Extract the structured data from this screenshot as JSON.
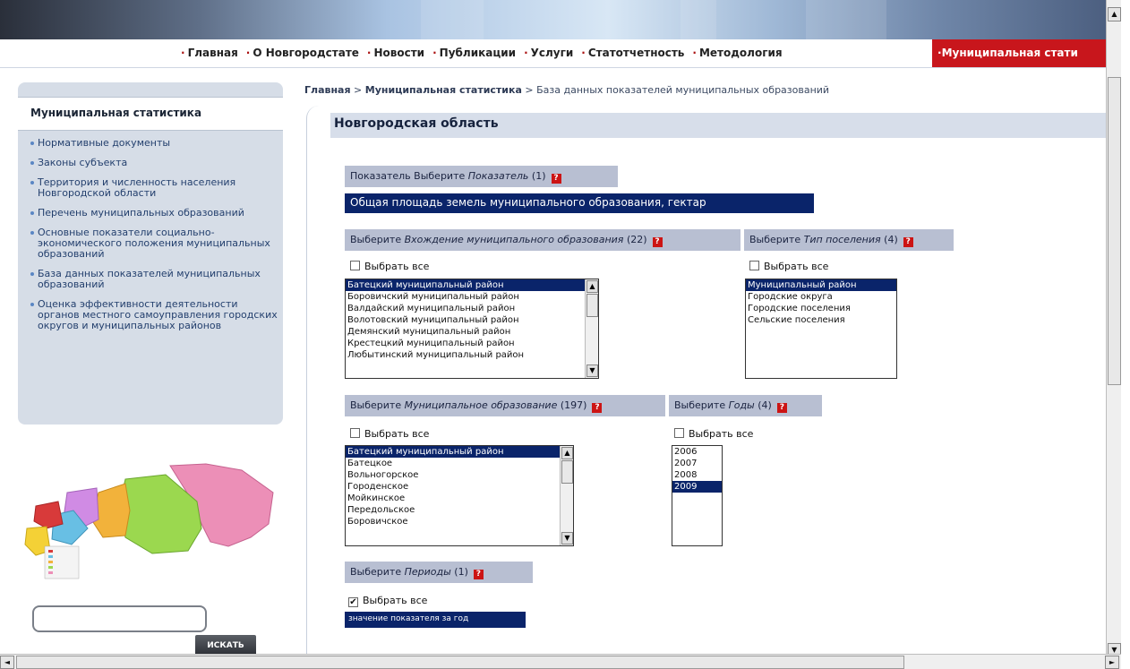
{
  "nav": {
    "items": [
      "Главная",
      "О Новгородстате",
      "Новости",
      "Публикации",
      "Услуги",
      "Статотчетность",
      "Методология"
    ],
    "active": "Муниципальная стати"
  },
  "sidebar": {
    "title": "Муниципальная статистика",
    "items": [
      "Нормативные документы",
      "Законы субъекта",
      "Территория и численность населения Новгородской области",
      "Перечень муниципальных образований",
      "Основные показатели социально-экономического положения муниципальных образований",
      "База данных показателей муниципальных образований",
      "Оценка эффективности деятельности органов местного самоуправления городских округов и муниципальных районов"
    ]
  },
  "search": {
    "button": "ИСКАТЬ"
  },
  "breadcrumb": {
    "home": "Главная",
    "section": "Муниципальная статистика",
    "current": "База данных показателей муниципальных образований",
    "sep": " > "
  },
  "region": "Новгородская область",
  "indicator": {
    "prefix": "Показатель Выберите ",
    "name": "Показатель",
    "count": "(1)",
    "value": "Общая площадь земель муниципального образования, гектар"
  },
  "select_all": "Выбрать все",
  "entry": {
    "prefix": "Выберите ",
    "name": "Вхождение муниципального образования",
    "count": "(22)",
    "options": [
      "Батецкий муниципальный район",
      "Боровичский муниципальный район",
      "Валдайский муниципальный район",
      "Волотовский муниципальный район",
      "Демянский муниципальный район",
      "Крестецкий муниципальный район",
      "Любытинский муниципальный район"
    ]
  },
  "settlement_type": {
    "prefix": "Выберите ",
    "name": "Тип поселения",
    "count": "(4)",
    "options": [
      "Муниципальный район",
      "Городские округа",
      "Городские поселения",
      "Сельские поселения"
    ]
  },
  "municipality": {
    "prefix": "Выберите ",
    "name": "Муниципальное образование",
    "count": "(197)",
    "options": [
      "Батецкий муниципальный район",
      "Батецкое",
      "Вольногорское",
      "Городенское",
      "Мойкинское",
      "Передольское",
      "Боровичское"
    ]
  },
  "years": {
    "prefix": "Выберите ",
    "name": "Годы",
    "count": "(4)",
    "options": [
      "2006",
      "2007",
      "2008",
      "2009"
    ]
  },
  "periods": {
    "prefix": "Выберите ",
    "name": "Периоды",
    "count": "(1)",
    "value": "значение показателя за год"
  },
  "icons": {
    "help": "help-icon",
    "scroll_up": "▲",
    "scroll_down": "▼",
    "scroll_left": "◄",
    "scroll_right": "►",
    "check": "✔"
  },
  "colors": {
    "accent_red": "#c8161c",
    "selection": "#0a246a",
    "label_bg": "#b8bfd2",
    "sidebar_bg": "#d6dde7"
  }
}
